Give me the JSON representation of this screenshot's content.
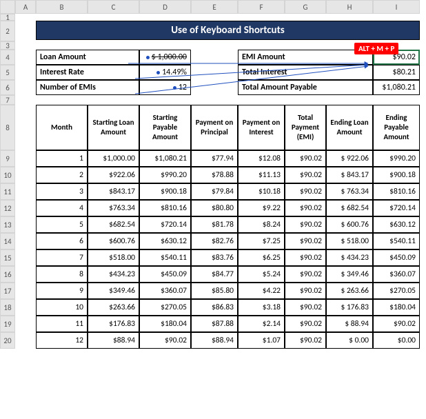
{
  "title": "Use of Keyboard Shortcuts",
  "shortcut_tag": "ALT + M + P",
  "col_letters": [
    "A",
    "B",
    "C",
    "D",
    "E",
    "F",
    "G",
    "H",
    "I"
  ],
  "summary_left": {
    "r1_label": "Loan Amount",
    "r1_value": "1,000.00",
    "r1_prefix": "$",
    "r2_label": "Interest Rate",
    "r2_value": "14.49%",
    "r3_label": "Number of EMIs",
    "r3_value": "12"
  },
  "summary_right": {
    "r1_label": "EMI Amount",
    "r1_value": "$90.02",
    "r2_label": "Total Interest",
    "r2_value": "$80.21",
    "r3_label": "Total Amount Payable",
    "r3_value": "$1,080.21"
  },
  "table_headers": [
    "Month",
    "Starting Loan Amount",
    "Starting Payable Amount",
    "Payment on Principal",
    "Payment on Interest",
    "Total Payment (EMI)",
    "Ending Loan Amount",
    "Ending Payable Amount"
  ],
  "rows": [
    {
      "m": "1",
      "sla": "$1,000.00",
      "spa": "$1,080.21",
      "pp": "$77.94",
      "pi": "$12.08",
      "tp": "$90.02",
      "ela": "$ 922.06",
      "epa": "$990.20"
    },
    {
      "m": "2",
      "sla": "$922.06",
      "spa": "$990.20",
      "pp": "$78.88",
      "pi": "$11.13",
      "tp": "$90.02",
      "ela": "$ 843.17",
      "epa": "$900.18"
    },
    {
      "m": "3",
      "sla": "$843.17",
      "spa": "$900.18",
      "pp": "$79.84",
      "pi": "$10.18",
      "tp": "$90.02",
      "ela": "$ 763.34",
      "epa": "$810.16"
    },
    {
      "m": "4",
      "sla": "$763.34",
      "spa": "$810.16",
      "pp": "$80.80",
      "pi": "$9.22",
      "tp": "$90.02",
      "ela": "$ 682.54",
      "epa": "$720.14"
    },
    {
      "m": "5",
      "sla": "$682.54",
      "spa": "$720.14",
      "pp": "$81.78",
      "pi": "$8.24",
      "tp": "$90.02",
      "ela": "$ 600.76",
      "epa": "$630.12"
    },
    {
      "m": "6",
      "sla": "$600.76",
      "spa": "$630.12",
      "pp": "$82.76",
      "pi": "$7.25",
      "tp": "$90.02",
      "ela": "$ 518.00",
      "epa": "$540.11"
    },
    {
      "m": "7",
      "sla": "$518.00",
      "spa": "$540.11",
      "pp": "$83.76",
      "pi": "$6.25",
      "tp": "$90.02",
      "ela": "$ 434.23",
      "epa": "$450.09"
    },
    {
      "m": "8",
      "sla": "$434.23",
      "spa": "$450.09",
      "pp": "$84.77",
      "pi": "$5.24",
      "tp": "$90.02",
      "ela": "$ 349.46",
      "epa": "$360.07"
    },
    {
      "m": "9",
      "sla": "$349.46",
      "spa": "$360.07",
      "pp": "$85.80",
      "pi": "$4.22",
      "tp": "$90.02",
      "ela": "$ 263.66",
      "epa": "$270.05"
    },
    {
      "m": "10",
      "sla": "$263.66",
      "spa": "$270.05",
      "pp": "$86.83",
      "pi": "$3.18",
      "tp": "$90.02",
      "ela": "$ 176.83",
      "epa": "$180.04"
    },
    {
      "m": "11",
      "sla": "$176.83",
      "spa": "$180.04",
      "pp": "$87.88",
      "pi": "$2.14",
      "tp": "$90.02",
      "ela": "$   88.94",
      "epa": "$90.02"
    },
    {
      "m": "12",
      "sla": "$88.94",
      "spa": "$90.02",
      "pp": "$88.94",
      "pi": "$1.07",
      "tp": "$90.02",
      "ela": "$     0.00",
      "epa": "$0.00"
    }
  ]
}
